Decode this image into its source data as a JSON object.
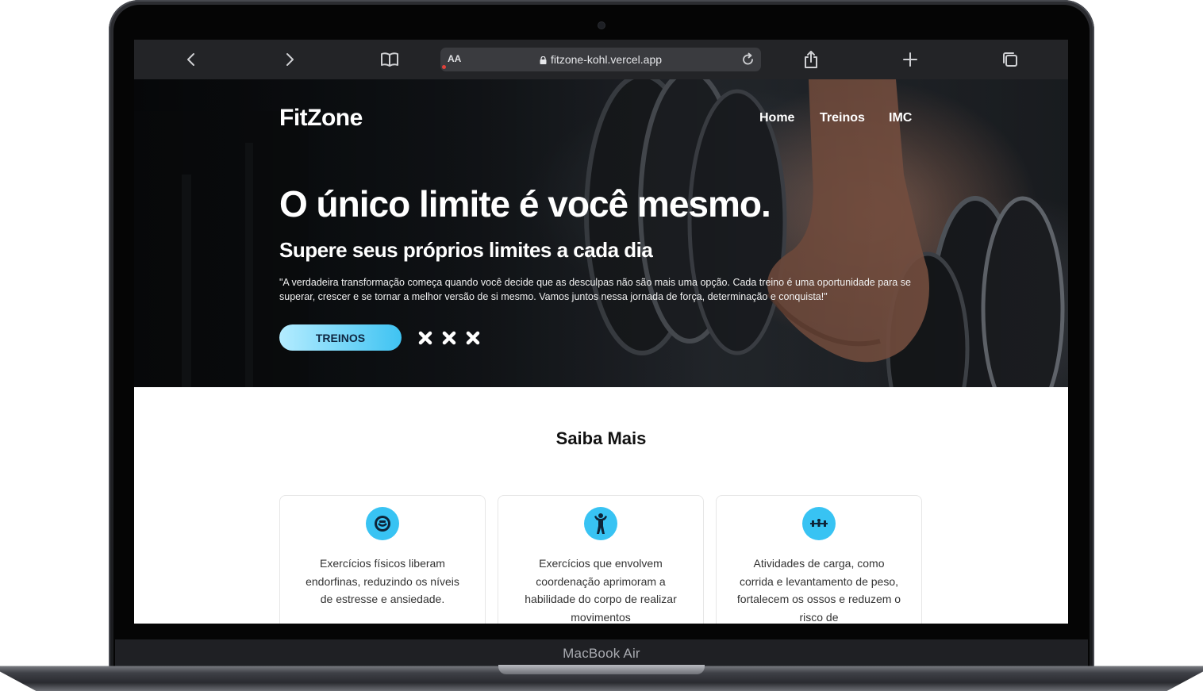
{
  "device": {
    "model": "MacBook Air"
  },
  "browser": {
    "aa_label": "AA",
    "url": "fitzone-kohl.vercel.app",
    "icons": [
      "back-icon",
      "forward-icon",
      "bookmarks-icon",
      "lock-icon",
      "reload-icon",
      "share-icon",
      "new-tab-icon",
      "tabs-icon"
    ]
  },
  "hero": {
    "logo": "FitZone",
    "nav": [
      "Home",
      "Treinos",
      "IMC"
    ],
    "title": "O único limite é você mesmo.",
    "subtitle": "Supere seus próprios limites a cada dia",
    "quote": "\"A verdadeira transformação começa quando você decide que as desculpas não são mais uma opção. Cada treino é uma oportunidade para se superar, crescer e se tornar a melhor versão de si mesmo. Vamos juntos nessa jornada de força, determinação e conquista!\"",
    "cta": "TREINOS",
    "accent": "#38c3f3"
  },
  "section": {
    "title": "Saiba Mais",
    "cards": [
      {
        "icon": "smile-icon",
        "text": "Exercícios físicos liberam endorfinas, reduzindo os níveis de estresse e ansiedade."
      },
      {
        "icon": "bodybuilder-icon",
        "text": "Exercícios que envolvem coordenação aprimoram a habilidade do corpo de realizar movimentos"
      },
      {
        "icon": "weightlifting-icon",
        "text": "Atividades de carga, como corrida e levantamento de peso, fortalecem os ossos e reduzem o risco de"
      }
    ]
  }
}
